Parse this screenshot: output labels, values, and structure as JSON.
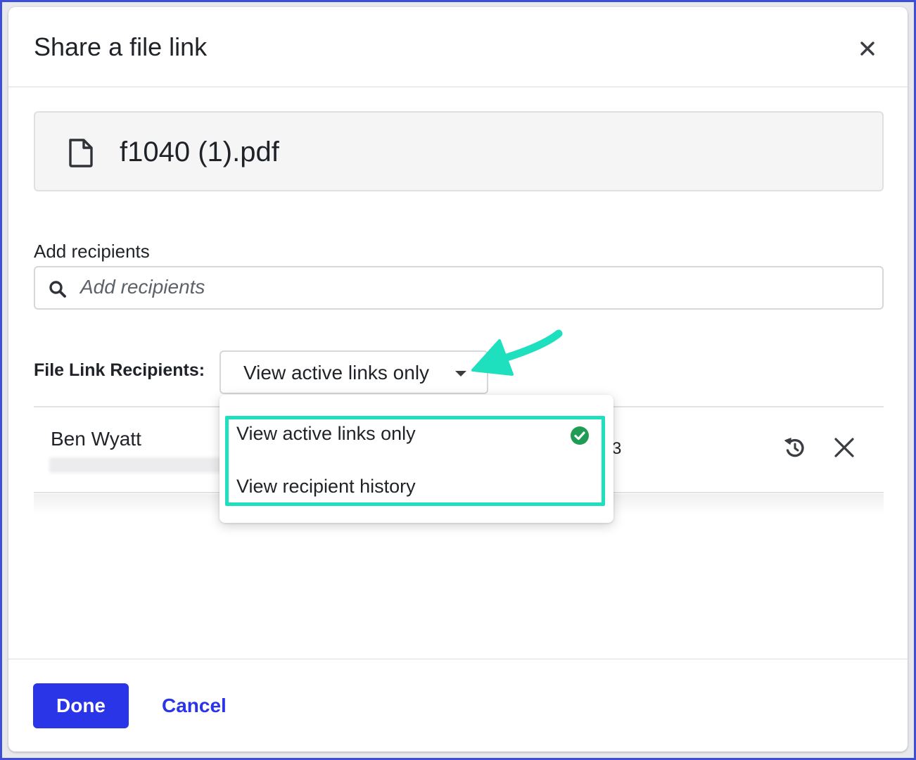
{
  "dialog": {
    "title": "Share a file link",
    "close_icon": "close-icon"
  },
  "file": {
    "icon": "file-icon",
    "name": "f1040 (1).pdf"
  },
  "recipients_input": {
    "label": "Add recipients",
    "placeholder": "Add recipients",
    "icon": "search-icon"
  },
  "file_link_recipients": {
    "label": "File Link Recipients:",
    "selected": "View active links only",
    "options": [
      "View active links only",
      "View recipient history"
    ],
    "selected_icon": "check-circle-icon"
  },
  "recipient_rows": [
    {
      "name": "Ben Wyatt",
      "trailing_text": "3",
      "actions": [
        "resend-icon",
        "remove-icon"
      ]
    }
  ],
  "footer": {
    "done_label": "Done",
    "cancel_label": "Cancel"
  },
  "colors": {
    "primary": "#2a35e8",
    "highlight": "#1ee0bf",
    "success": "#1f9d55",
    "frame": "#3d4fd6"
  }
}
